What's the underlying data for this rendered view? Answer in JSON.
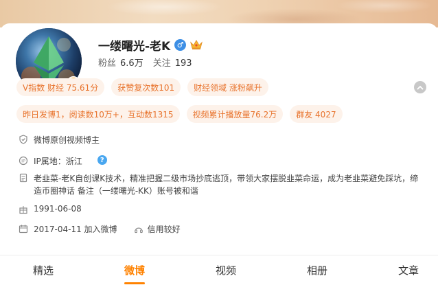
{
  "profile": {
    "name": "一缕曙光-老K",
    "fans_label": "粉丝",
    "fans_count": "6.6万",
    "follow_label": "关注",
    "follow_count": "193",
    "verify_badge": "V"
  },
  "tags_row1": [
    {
      "label": "V指数 财经 75.61分"
    },
    {
      "label": "获赞复次数101"
    },
    {
      "label": "财经领域 涨粉飙升"
    }
  ],
  "tags_row2": [
    {
      "label": "昨日发博1，阅读数10万+，互动数1315"
    },
    {
      "label": "视频累计播放量76.2万"
    },
    {
      "label": "群友 4027"
    }
  ],
  "info": {
    "role": "微博原创视频博主",
    "ip": "IP属地：浙江",
    "bio": "老韭菜-老K自创课K技术，精准把握二级市场抄底逃顶，带领大家摆脱韭菜命运，成为老韭菜避免踩坑，缔造币圈神话 备注（一缕曙光-KK）账号被和谐",
    "birthday": "1991-06-08",
    "joined": "2017-04-11 加入微博",
    "credit": "信用较好"
  },
  "tabs": [
    {
      "label": "精选"
    },
    {
      "label": "微博"
    },
    {
      "label": "视频"
    },
    {
      "label": "相册"
    },
    {
      "label": "文章"
    }
  ],
  "active_tab": "微博",
  "colors": {
    "accent": "#ff8200",
    "tag_text": "#e8732c",
    "tag_bg": "#fdf2ea",
    "verified": "#f5a623"
  },
  "icons": [
    "shield-icon",
    "location-icon",
    "document-icon",
    "gift-icon",
    "calendar-icon",
    "headset-icon",
    "crown-icon",
    "male-icon",
    "help-icon",
    "chevron-up-icon"
  ]
}
